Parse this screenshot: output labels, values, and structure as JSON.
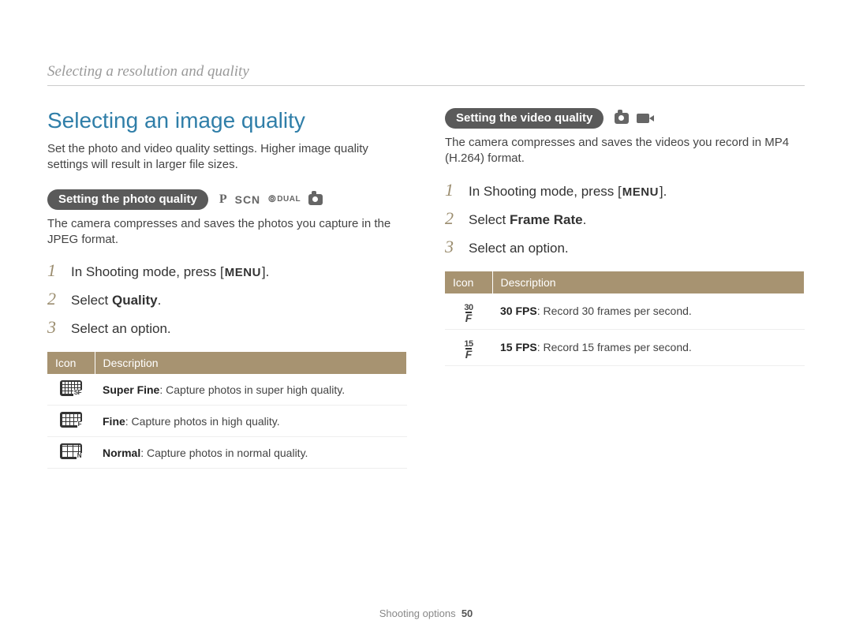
{
  "breadcrumb": "Selecting a resolution and quality",
  "main_heading": "Selecting an image quality",
  "intro": "Set the photo and video quality settings. Higher image quality settings will result in larger file sizes.",
  "photo": {
    "pill": "Setting the photo quality",
    "modes": {
      "p": "P",
      "scn": "SCN",
      "dual": "DUAL"
    },
    "intro": "The camera compresses and saves the photos you capture in the JPEG format.",
    "steps": [
      {
        "num": "1",
        "prefix": "In Shooting mode, press [",
        "badge": "MENU",
        "suffix": "]."
      },
      {
        "num": "2",
        "prefix": "Select ",
        "strong": "Quality",
        "suffix": "."
      },
      {
        "num": "3",
        "prefix": "Select an option.",
        "strong": "",
        "suffix": ""
      }
    ],
    "table": {
      "headers": [
        "Icon",
        "Description"
      ],
      "rows": [
        {
          "icon_sub": "SF",
          "icon_class": "sf",
          "label": "Super Fine",
          "desc": ": Capture photos in super high quality."
        },
        {
          "icon_sub": "F",
          "icon_class": "fine",
          "label": "Fine",
          "desc": ": Capture photos in high quality."
        },
        {
          "icon_sub": "N",
          "icon_class": "normal",
          "label": "Normal",
          "desc": ": Capture photos in normal quality."
        }
      ]
    }
  },
  "video": {
    "pill": "Setting the video quality",
    "intro": "The camera compresses and saves the videos you record in MP4 (H.264) format.",
    "steps": [
      {
        "num": "1",
        "prefix": "In Shooting mode, press [",
        "badge": "MENU",
        "suffix": "]."
      },
      {
        "num": "2",
        "prefix": "Select ",
        "strong": "Frame Rate",
        "suffix": "."
      },
      {
        "num": "3",
        "prefix": "Select an option.",
        "strong": "",
        "suffix": ""
      }
    ],
    "table": {
      "headers": [
        "Icon",
        "Description"
      ],
      "rows": [
        {
          "fps_top": "30",
          "label": "30 FPS",
          "desc": ": Record 30 frames per second."
        },
        {
          "fps_top": "15",
          "label": "15 FPS",
          "desc": ": Record 15 frames per second."
        }
      ]
    }
  },
  "footer": {
    "section": "Shooting options",
    "page": "50"
  }
}
